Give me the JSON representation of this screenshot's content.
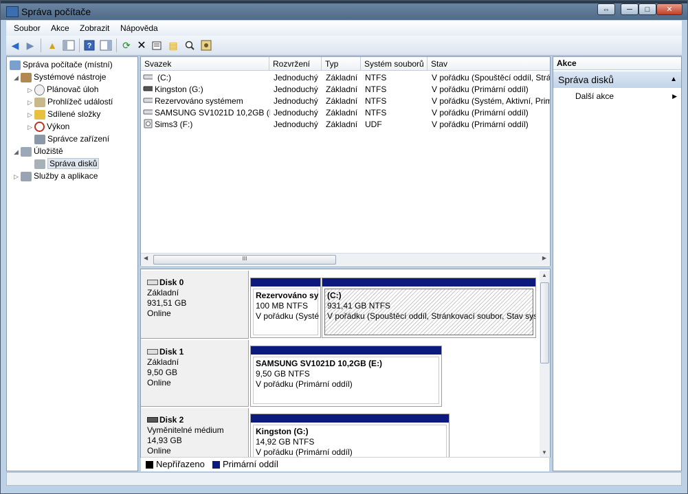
{
  "window": {
    "title": "Správa počítače",
    "caption_buttons": [
      "⇔",
      "─",
      "□",
      "✕"
    ]
  },
  "menu": [
    "Soubor",
    "Akce",
    "Zobrazit",
    "Nápověda"
  ],
  "toolbar_icons": [
    "back-icon",
    "forward-icon",
    "up-folder-icon",
    "show-tree-icon",
    "help-icon",
    "show-action-pane-icon",
    "refresh-icon",
    "delete-icon",
    "properties-icon",
    "open-folder-icon",
    "search-icon",
    "settings-icon"
  ],
  "tree": [
    {
      "label": "Správa počítače (místní)",
      "icon": "computer-icon",
      "expander": ""
    },
    {
      "label": "Systémové nástroje",
      "icon": "tools-icon",
      "expander": "◢"
    },
    {
      "label": "Plánovač úloh",
      "icon": "clock-icon",
      "expander": "▷"
    },
    {
      "label": "Prohlížeč událostí",
      "icon": "event-viewer-icon",
      "expander": "▷"
    },
    {
      "label": "Sdílené složky",
      "icon": "shared-folder-icon",
      "expander": "▷"
    },
    {
      "label": "Výkon",
      "icon": "performance-icon",
      "expander": "▷"
    },
    {
      "label": "Správce zařízení",
      "icon": "device-manager-icon",
      "expander": ""
    },
    {
      "label": "Úložiště",
      "icon": "storage-icon",
      "expander": "◢"
    },
    {
      "label": "Správa disků",
      "icon": "disk-management-icon",
      "expander": ""
    },
    {
      "label": "Služby a aplikace",
      "icon": "services-icon",
      "expander": "▷"
    }
  ],
  "volume_columns": [
    "Svazek",
    "Rozvržení",
    "Typ",
    "Systém souborů",
    "Stav"
  ],
  "volumes": [
    {
      "name": "(C:)",
      "layout": "Jednoduchý",
      "type": "Základní",
      "fs": "NTFS",
      "status": "V pořádku (Spouštěcí oddíl, Strán"
    },
    {
      "name": "Kingston (G:)",
      "layout": "Jednoduchý",
      "type": "Základní",
      "fs": "NTFS",
      "status": "V pořádku (Primární oddíl)"
    },
    {
      "name": "Rezervováno systémem",
      "layout": "Jednoduchý",
      "type": "Základní",
      "fs": "NTFS",
      "status": "V pořádku (Systém, Aktivní, Prim"
    },
    {
      "name": "SAMSUNG SV1021D 10,2GB (E:)",
      "layout": "Jednoduchý",
      "type": "Základní",
      "fs": "NTFS",
      "status": "V pořádku (Primární oddíl)"
    },
    {
      "name": "Sims3 (F:)",
      "layout": "Jednoduchý",
      "type": "Základní",
      "fs": "UDF",
      "status": "V pořádku (Primární oddíl)"
    }
  ],
  "hscroll_thumb": "III",
  "disks": [
    {
      "name": "Disk 0",
      "kind": "Základní",
      "size": "931,51 GB",
      "state": "Online",
      "partitions": [
        {
          "title": "Rezervováno sy",
          "size": "100 MB NTFS",
          "status": "V pořádku (Systé"
        },
        {
          "title": "(C:)",
          "size": "931,41 GB NTFS",
          "status": "V pořádku (Spouštěcí oddíl, Stránkovací soubor, Stav sys"
        }
      ]
    },
    {
      "name": "Disk 1",
      "kind": "Základní",
      "size": "9,50 GB",
      "state": "Online",
      "partitions": [
        {
          "title": "SAMSUNG SV1021D 10,2GB  (E:)",
          "size": "9,50 GB NTFS",
          "status": "V pořádku (Primární oddíl)"
        }
      ]
    },
    {
      "name": "Disk 2",
      "kind": "Vyměnitelné médium",
      "size": "14,93 GB",
      "state": "Online",
      "partitions": [
        {
          "title": "Kingston  (G:)",
          "size": "14,92 GB NTFS",
          "status": "V pořádku (Primární oddíl)"
        }
      ]
    }
  ],
  "legend": [
    {
      "label": "Nepřiřazeno",
      "color": "#000000"
    },
    {
      "label": "Primární oddíl",
      "color": "#0c1a80"
    }
  ],
  "actions": {
    "header": "Akce",
    "section": "Správa disků",
    "item": "Další akce"
  }
}
